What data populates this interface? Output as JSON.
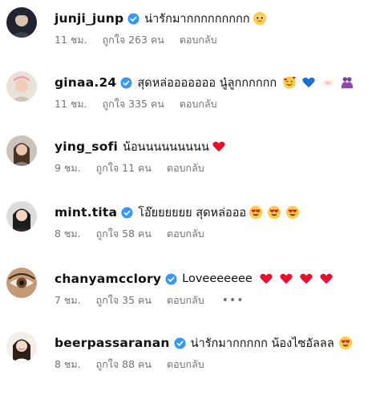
{
  "comments": [
    {
      "username": "junji_junp",
      "verified": true,
      "text": "น่ารักมากกกกกกกกก",
      "emojis": [
        "pleading-face-emoji"
      ],
      "time": "11 ชม.",
      "likes": "ถูกใจ 263 คน",
      "reply": "ตอบกลับ"
    },
    {
      "username": "ginaa.24",
      "verified": true,
      "text": "สุดหล่อออออออ นู๋ลูกกกกกก",
      "emojis": [
        "smiling-face-with-hearts-emoji",
        "blue-heart-emoji",
        "heart-hands-emoji",
        "hugging-people-emoji"
      ],
      "time": "11 ชม.",
      "likes": "ถูกใจ 335 คน",
      "reply": "ตอบกลับ"
    },
    {
      "username": "ying_sofi",
      "verified": false,
      "text": "น้อนนนนนนนนน",
      "emojis": [
        "red-heart-emoji"
      ],
      "time": "9 ชม.",
      "likes": "ถูกใจ 11 คน",
      "reply": "ตอบกลับ"
    },
    {
      "username": "mint.tita",
      "verified": true,
      "text": "โอ๊ยยยยยย สุดหล่อออ",
      "emojis": [
        "heart-eyes-emoji",
        "heart-eyes-emoji",
        "heart-eyes-emoji"
      ],
      "time": "8 ชม.",
      "likes": "ถูกใจ 58 คน",
      "reply": "ตอบกลับ"
    },
    {
      "username": "chanyamcclory",
      "verified": true,
      "text": "Loveeeeeee",
      "emojis": [
        "red-heart-emoji",
        "red-heart-emoji",
        "red-heart-emoji",
        "red-heart-emoji"
      ],
      "time": "7 ชม.",
      "likes": "ถูกใจ 35 คน",
      "reply": "ตอบกลับ",
      "more": "•••"
    },
    {
      "username": "beerpassaranan",
      "verified": true,
      "text": "น่ารักมากกกกก น้องไซอัลลล",
      "emojis": [
        "heart-eyes-emoji"
      ],
      "time": "8 ชม.",
      "likes": "ถูกใจ 88 คน",
      "reply": "ตอบกลับ"
    }
  ],
  "colors": {
    "verified_blue": "#3897f0",
    "meta_gray": "#737373",
    "heart_red": "#e8112d"
  }
}
